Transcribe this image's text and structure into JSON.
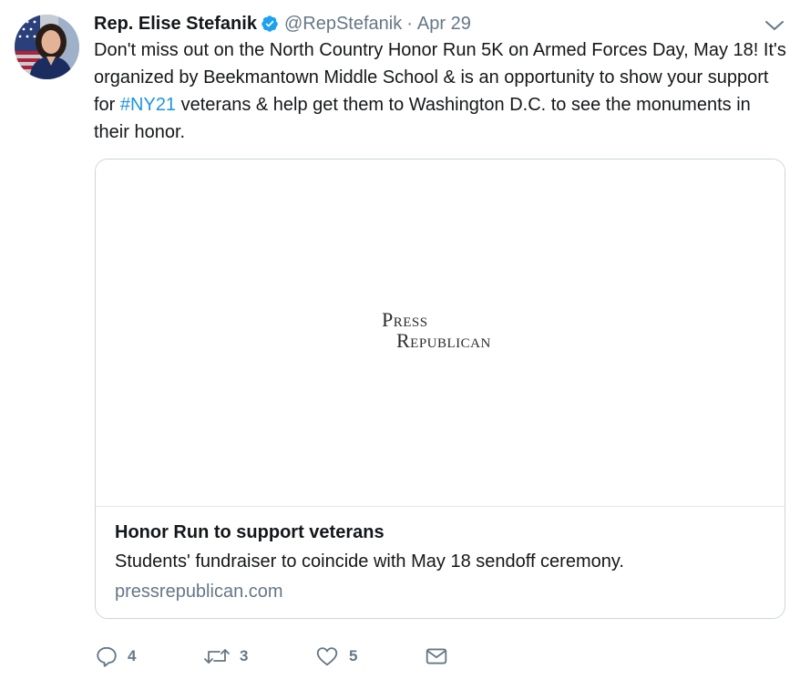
{
  "author": {
    "name": "Rep. Elise Stefanik",
    "handle": "@RepStefanik",
    "separator": "·",
    "date": "Apr 29"
  },
  "tweet": {
    "text_before": "Don't miss out on the North Country Honor Run 5K on Armed Forces Day, May 18! It's organized by Beekmantown Middle School & is an opportunity to show your support for ",
    "hashtag": "#NY21",
    "text_after": " veterans & help get them to Washington D.C. to see the monuments in their honor."
  },
  "card": {
    "logo_line1": "Press",
    "logo_line2": "Republican",
    "title": "Honor Run to support veterans",
    "description": "Students' fundraiser to coincide with May 18 sendoff ceremony.",
    "domain": "pressrepublican.com"
  },
  "actions": {
    "reply": {
      "icon": "reply-icon",
      "count": "4"
    },
    "retweet": {
      "icon": "retweet-icon",
      "count": "3"
    },
    "like": {
      "icon": "heart-icon",
      "count": "5"
    },
    "dm": {
      "icon": "envelope-icon"
    }
  },
  "colors": {
    "accent": "#1b95e0",
    "verified": "#1da1f2",
    "muted": "#657786",
    "text": "#14171a",
    "border": "#ccd6dd"
  }
}
